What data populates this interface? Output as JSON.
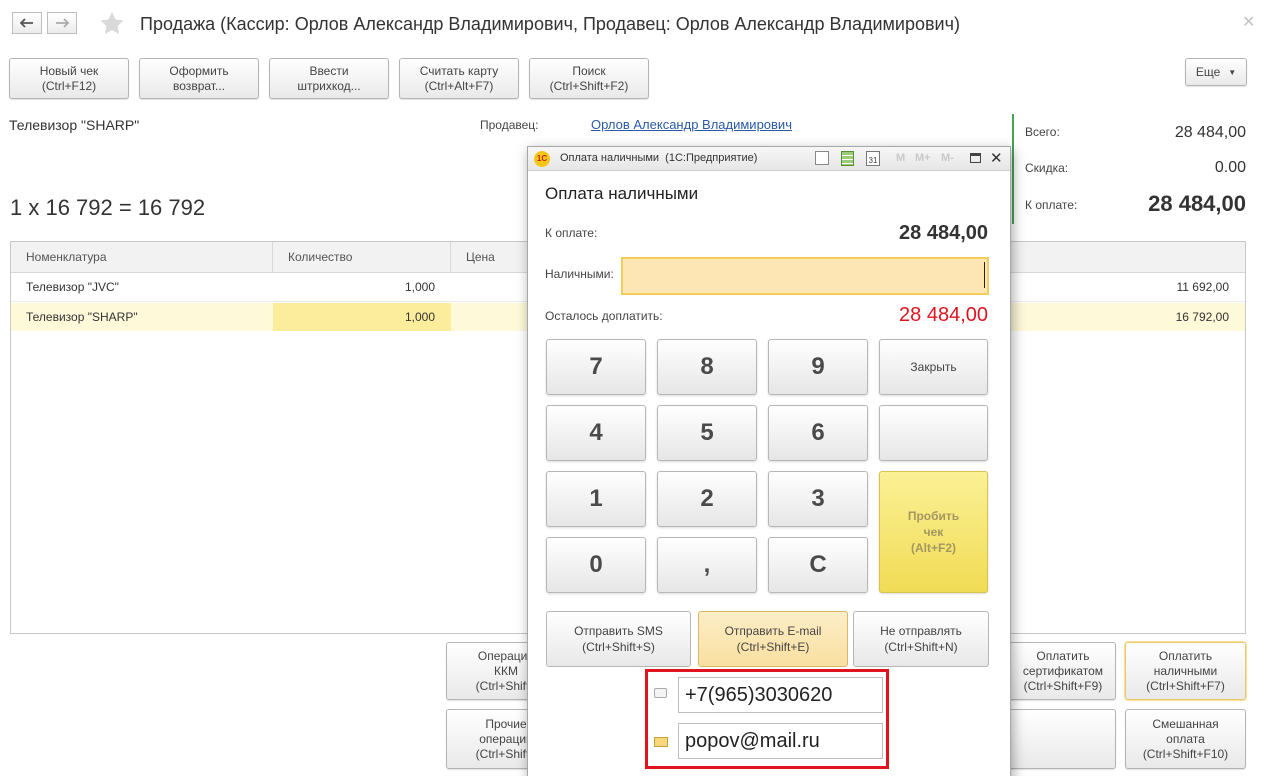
{
  "header": {
    "title": "Продажа (Кассир: Орлов Александр Владимирович, Продавец: Орлов Александр Владимирович)"
  },
  "toolbar": {
    "buttons": [
      {
        "label": "Новый чек\n(Ctrl+F12)"
      },
      {
        "label": "Оформить\nвозврат..."
      },
      {
        "label": "Ввести\nштрихкод..."
      },
      {
        "label": "Считать карту\n(Ctrl+Alt+F7)"
      },
      {
        "label": "Поиск\n(Ctrl+Shift+F2)"
      }
    ],
    "more_label": "Еще"
  },
  "current_item": {
    "name": "Телевизор \"SHARP\"",
    "calc": "1 x 16 792 = 16 792"
  },
  "seller": {
    "label": "Продавец:",
    "value": "Орлов Александр Владимирович"
  },
  "totals": {
    "total_label": "Всего:",
    "total_value": "28 484,00",
    "discount_label": "Скидка:",
    "discount_value": "0.00",
    "to_pay_label": "К оплате:",
    "to_pay_value": "28 484,00"
  },
  "table": {
    "columns": [
      "Номенклатура",
      "Количество",
      "Цена"
    ],
    "rows": [
      {
        "name": "Телевизор \"JVC\"",
        "qty": "1,000",
        "sum": "11 692,00"
      },
      {
        "name": "Телевизор \"SHARP\"",
        "qty": "1,000",
        "sum": "16 792,00"
      }
    ]
  },
  "bottom_buttons": {
    "kkm": "Операции\nККМ\n(Ctrl+Shift+",
    "other": "Прочие\nоперации\n(Ctrl+Shift+",
    "cert": "Оплатить\nсертификатом\n(Ctrl+Shift+F9)",
    "cash": "Оплатить\nналичными\n(Ctrl+Shift+F7)",
    "mixed": "Смешанная\nоплата\n(Ctrl+Shift+F10)"
  },
  "dialog": {
    "window_title": "Оплата наличными  (1С:Предприятие)",
    "heading": "Оплата наличными",
    "to_pay_label": "К оплате:",
    "to_pay_value": "28 484,00",
    "cash_label": "Наличными:",
    "cash_value": "",
    "remaining_label": "Осталось доплатить:",
    "remaining_value": "28 484,00",
    "keys": [
      "7",
      "8",
      "9",
      "4",
      "5",
      "6",
      "1",
      "2",
      "3",
      "0",
      ",",
      "C"
    ],
    "close_label": "Закрыть",
    "print_label": "Пробить\nчек\n(Alt+F2)",
    "send_sms": "Отправить SMS\n(Ctrl+Shift+S)",
    "send_email": "Отправить E-mail\n(Ctrl+Shift+E)",
    "no_send": "Не отправлять\n(Ctrl+Shift+N)",
    "phone": "+7(965)3030620",
    "email": "popov@mail.ru"
  },
  "colors": {
    "accent_green": "#4aa351",
    "remaining_red": "#e0141e",
    "highlight_row": "#fdf9d9",
    "input_fill": "#fde6b3",
    "annotation_red": "#e0141e"
  }
}
